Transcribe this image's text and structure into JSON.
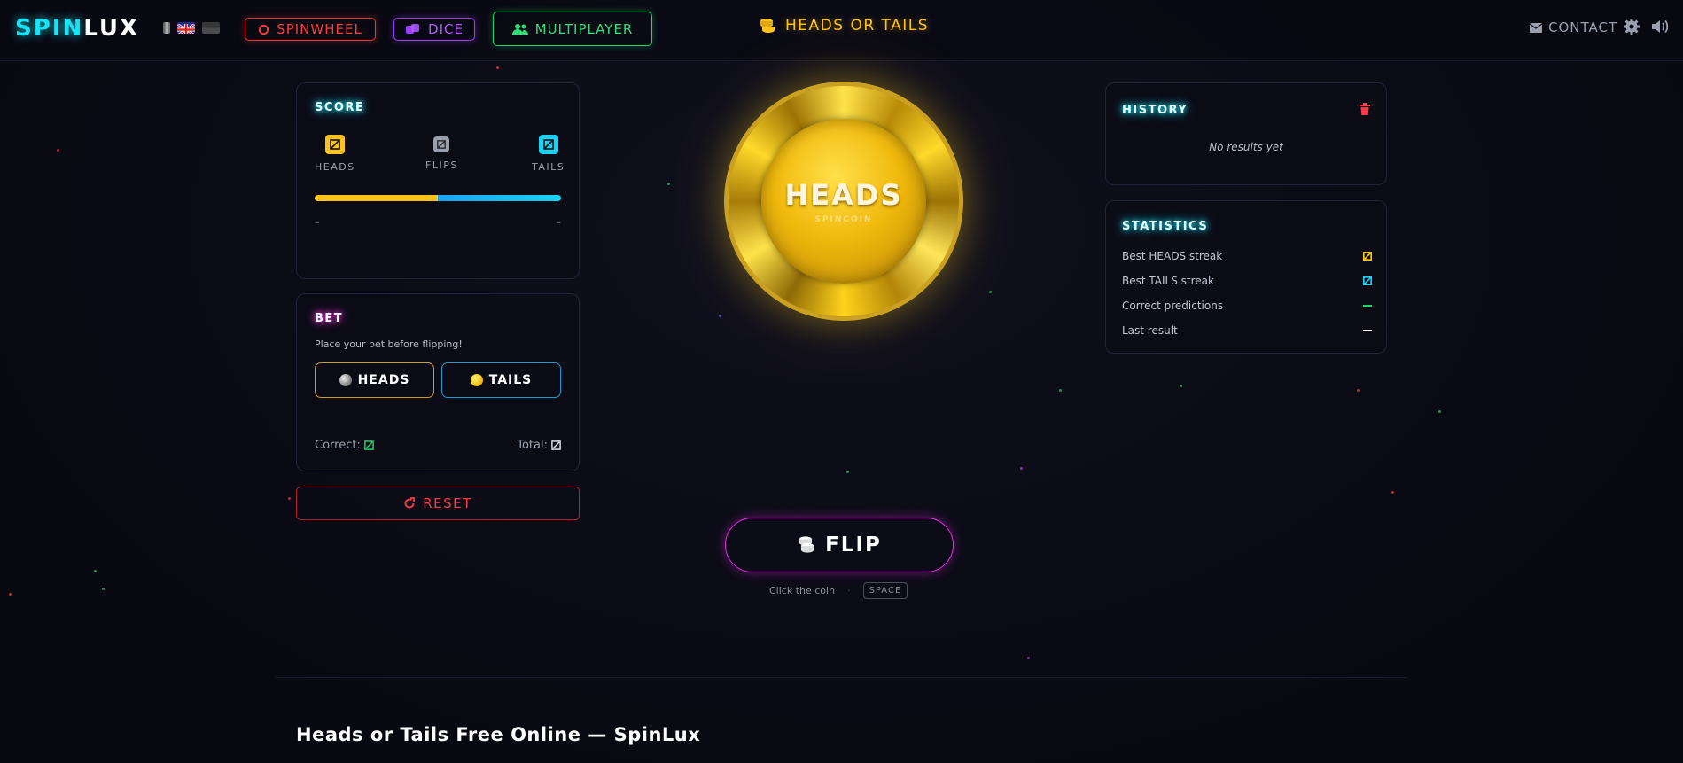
{
  "nav": {
    "logo_part1": "SPIN",
    "logo_part2": "LUX",
    "languages": [
      "it",
      "en",
      "other"
    ],
    "spinwheel_label": "SPINWHEEL",
    "dice_label": "DICE",
    "multiplayer_label": "MULTIPLAYER",
    "game_title": "HEADS OR TAILS",
    "contact_label": "CONTACT"
  },
  "score": {
    "title": "SCORE",
    "heads_label": "HEADS",
    "flips_label": "FLIPS",
    "tails_label": "TAILS",
    "heads_pct_text": "–",
    "tails_pct_text": "–",
    "heads_ratio": 0.5
  },
  "bet": {
    "title": "BET",
    "subtitle": "Place your bet before flipping!",
    "heads_label": "HEADS",
    "tails_label": "TAILS",
    "correct_label": "Correct:",
    "total_label": "Total:"
  },
  "reset_label": "RESET",
  "coin": {
    "face_text": "HEADS",
    "brand_text": "SPINCOIN"
  },
  "flip_label": "FLIP",
  "hint": {
    "text": "Click the coin",
    "key": "SPACE"
  },
  "history": {
    "title": "HISTORY",
    "empty_text": "No results yet"
  },
  "statistics": {
    "title": "STATISTICS",
    "rows": [
      {
        "label": "Best HEADS streak"
      },
      {
        "label": "Best TAILS streak"
      },
      {
        "label": "Correct predictions"
      },
      {
        "label": "Last result"
      }
    ]
  },
  "seo_title": "Heads or Tails Free Online — SpinLux",
  "colors": {
    "cyan": "#19e3f5",
    "gold": "#ffc21a",
    "red": "#ff3a3a",
    "purple": "#9b3cff",
    "green": "#22d36a",
    "magenta": "#e12be0"
  }
}
